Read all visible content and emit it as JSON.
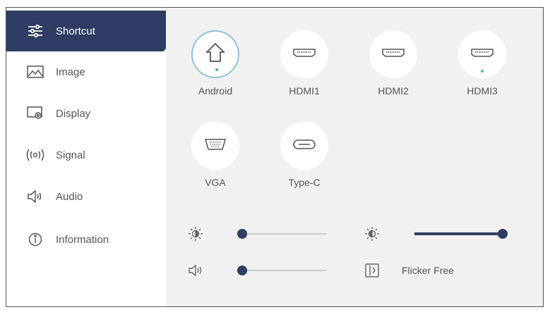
{
  "sidebar": {
    "items": [
      {
        "label": "Shortcut",
        "icon": "sliders-icon",
        "active": true
      },
      {
        "label": "Image",
        "icon": "image-icon",
        "active": false
      },
      {
        "label": "Display",
        "icon": "display-settings-icon",
        "active": false
      },
      {
        "label": "Signal",
        "icon": "signal-icon",
        "active": false
      },
      {
        "label": "Audio",
        "icon": "speaker-icon",
        "active": false
      },
      {
        "label": "Information",
        "icon": "info-icon",
        "active": false
      }
    ]
  },
  "sources": [
    {
      "label": "Android",
      "icon": "home-icon",
      "selected": true
    },
    {
      "label": "HDMI1",
      "icon": "hdmi-icon",
      "selected": false
    },
    {
      "label": "HDMI2",
      "icon": "hdmi-icon",
      "selected": false
    },
    {
      "label": "HDMI3",
      "icon": "hdmi-icon",
      "selected": false
    },
    {
      "label": "VGA",
      "icon": "vga-icon",
      "selected": false
    },
    {
      "label": "Type-C",
      "icon": "usb-c-icon",
      "selected": false
    }
  ],
  "controls": {
    "brightness": {
      "icon": "brightness-icon",
      "value": 0.05
    },
    "contrast": {
      "icon": "contrast-icon",
      "value": 1.0
    },
    "volume": {
      "icon": "speaker-icon",
      "value": 0.05
    },
    "flicker_free": {
      "icon": "flicker-free-icon",
      "label": "Flicker Free"
    }
  },
  "colors": {
    "accent": "#2f3c63",
    "panel": "#f1f1f1",
    "selected_ring": "#8fc3d6",
    "status_dot_blue": "#49a8c8",
    "status_dot_green": "#4cc38a"
  }
}
